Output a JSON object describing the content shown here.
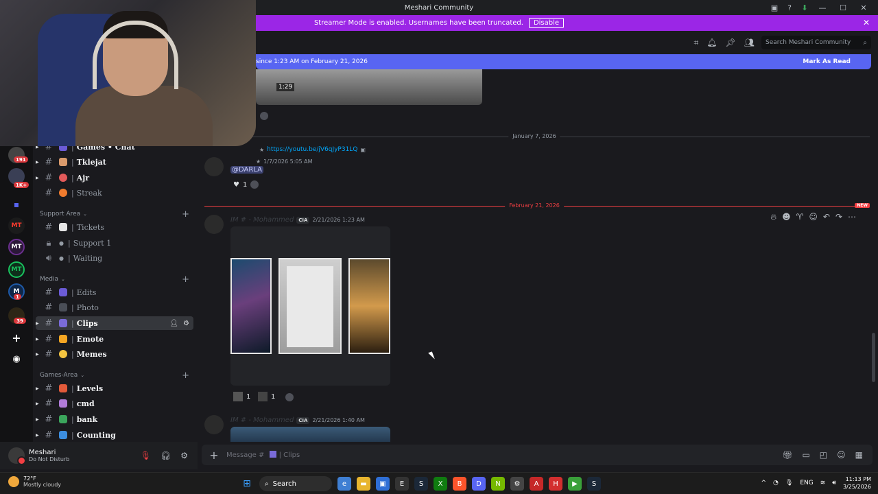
{
  "window": {
    "title": "Meshari Community"
  },
  "streamer_banner": {
    "text": "Streamer Mode is enabled. Usernames have been truncated.",
    "button": "Disable"
  },
  "header": {
    "search_placeholder": "Search Meshari Community"
  },
  "new_messages_bar": {
    "text": "since 1:23 AM on February 21, 2026",
    "action": "Mark As Read"
  },
  "guild_badges": [
    "191",
    "1K+",
    "1",
    "39"
  ],
  "guild_icons": [
    {
      "label": "MT",
      "color": "#ff3b2f"
    },
    {
      "label": "MT",
      "color": "#6b2f8f"
    },
    {
      "label": "MT",
      "color": "#19c25e"
    },
    {
      "label": "M",
      "color": "#1e5aa8"
    }
  ],
  "channels": {
    "top": [
      {
        "name": "Games • Chat",
        "unread": true
      },
      {
        "name": "Tklejat",
        "unread": true
      },
      {
        "name": "Ajr",
        "unread": true
      },
      {
        "name": "Streak",
        "unread": false
      }
    ],
    "support_area": {
      "label": "Support Area",
      "items": [
        {
          "name": "Tickets"
        },
        {
          "name": "Support 1"
        },
        {
          "name": "Waiting"
        }
      ]
    },
    "media": {
      "label": "Media",
      "items": [
        {
          "name": "Edits"
        },
        {
          "name": "Photo"
        },
        {
          "name": "Clips"
        },
        {
          "name": "Emote"
        },
        {
          "name": "Memes"
        }
      ]
    },
    "games_area": {
      "label": "Games-Area",
      "items": [
        {
          "name": "Levels"
        },
        {
          "name": "cmd"
        },
        {
          "name": "bank"
        },
        {
          "name": "Counting"
        }
      ]
    }
  },
  "user": {
    "name": "Meshari",
    "status": "Do Not Disturb"
  },
  "messages": {
    "timer": "1:29",
    "divider_jan": "January 7, 2026",
    "msg1": {
      "link": "https://youtu.be/jV6qJyP31LQ",
      "timestamp": "1/7/2026 5:05 AM",
      "mention": "@DARLA",
      "reaction_count": "1"
    },
    "divider_feb": "February 21, 2026",
    "new_tag": "NEW",
    "msg2": {
      "author": "IM # - Mohammed",
      "tag": "CIA",
      "timestamp": "2/21/2026 1:23 AM",
      "reaction1": "1",
      "reaction2": "1"
    },
    "msg3": {
      "author": "IM # - Mohammed",
      "tag": "CIA",
      "timestamp": "2/21/2026 1:40 AM"
    }
  },
  "composer": {
    "prefix": "Message #",
    "channel": "Clips"
  },
  "taskbar": {
    "weather_temp": "72°F",
    "weather_desc": "Mostly cloudy",
    "search": "Search",
    "lang": "ENG",
    "time": "11:13 PM",
    "date": "3/25/2026"
  }
}
